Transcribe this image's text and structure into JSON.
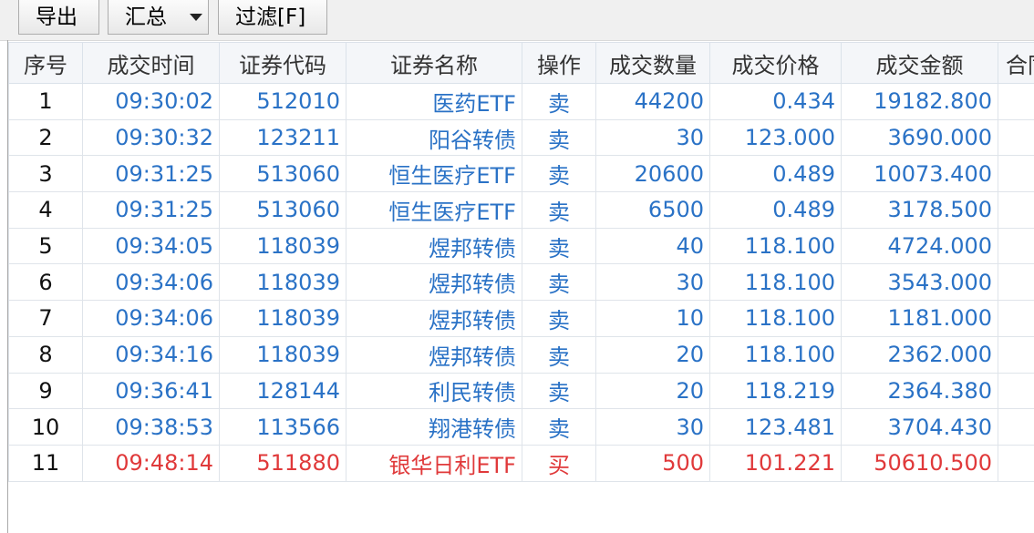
{
  "toolbar": {
    "export_label": "导出",
    "summary_label": "汇总",
    "filter_label": "过滤[F]"
  },
  "columns": [
    "序号",
    "成交时间",
    "证券代码",
    "证券名称",
    "操作",
    "成交数量",
    "成交价格",
    "成交金额",
    "合同"
  ],
  "rows": [
    {
      "seq": "1",
      "time": "09:30:02",
      "code": "512010",
      "name": "医药ETF",
      "op": "卖",
      "qty": "44200",
      "price": "0.434",
      "amount": "19182.800"
    },
    {
      "seq": "2",
      "time": "09:30:32",
      "code": "123211",
      "name": "阳谷转债",
      "op": "卖",
      "qty": "30",
      "price": "123.000",
      "amount": "3690.000"
    },
    {
      "seq": "3",
      "time": "09:31:25",
      "code": "513060",
      "name": "恒生医疗ETF",
      "op": "卖",
      "qty": "20600",
      "price": "0.489",
      "amount": "10073.400"
    },
    {
      "seq": "4",
      "time": "09:31:25",
      "code": "513060",
      "name": "恒生医疗ETF",
      "op": "卖",
      "qty": "6500",
      "price": "0.489",
      "amount": "3178.500"
    },
    {
      "seq": "5",
      "time": "09:34:05",
      "code": "118039",
      "name": "煜邦转债",
      "op": "卖",
      "qty": "40",
      "price": "118.100",
      "amount": "4724.000"
    },
    {
      "seq": "6",
      "time": "09:34:06",
      "code": "118039",
      "name": "煜邦转债",
      "op": "卖",
      "qty": "30",
      "price": "118.100",
      "amount": "3543.000"
    },
    {
      "seq": "7",
      "time": "09:34:06",
      "code": "118039",
      "name": "煜邦转债",
      "op": "卖",
      "qty": "10",
      "price": "118.100",
      "amount": "1181.000"
    },
    {
      "seq": "8",
      "time": "09:34:16",
      "code": "118039",
      "name": "煜邦转债",
      "op": "卖",
      "qty": "20",
      "price": "118.100",
      "amount": "2362.000"
    },
    {
      "seq": "9",
      "time": "09:36:41",
      "code": "128144",
      "name": "利民转债",
      "op": "卖",
      "qty": "20",
      "price": "118.219",
      "amount": "2364.380"
    },
    {
      "seq": "10",
      "time": "09:38:53",
      "code": "113566",
      "name": "翔港转债",
      "op": "卖",
      "qty": "30",
      "price": "123.481",
      "amount": "3704.430"
    },
    {
      "seq": "11",
      "time": "09:48:14",
      "code": "511880",
      "name": "银华日利ETF",
      "op": "买",
      "qty": "500",
      "price": "101.221",
      "amount": "50610.500"
    }
  ],
  "colors": {
    "sell": "#2a72c6",
    "buy": "#e0393a"
  }
}
